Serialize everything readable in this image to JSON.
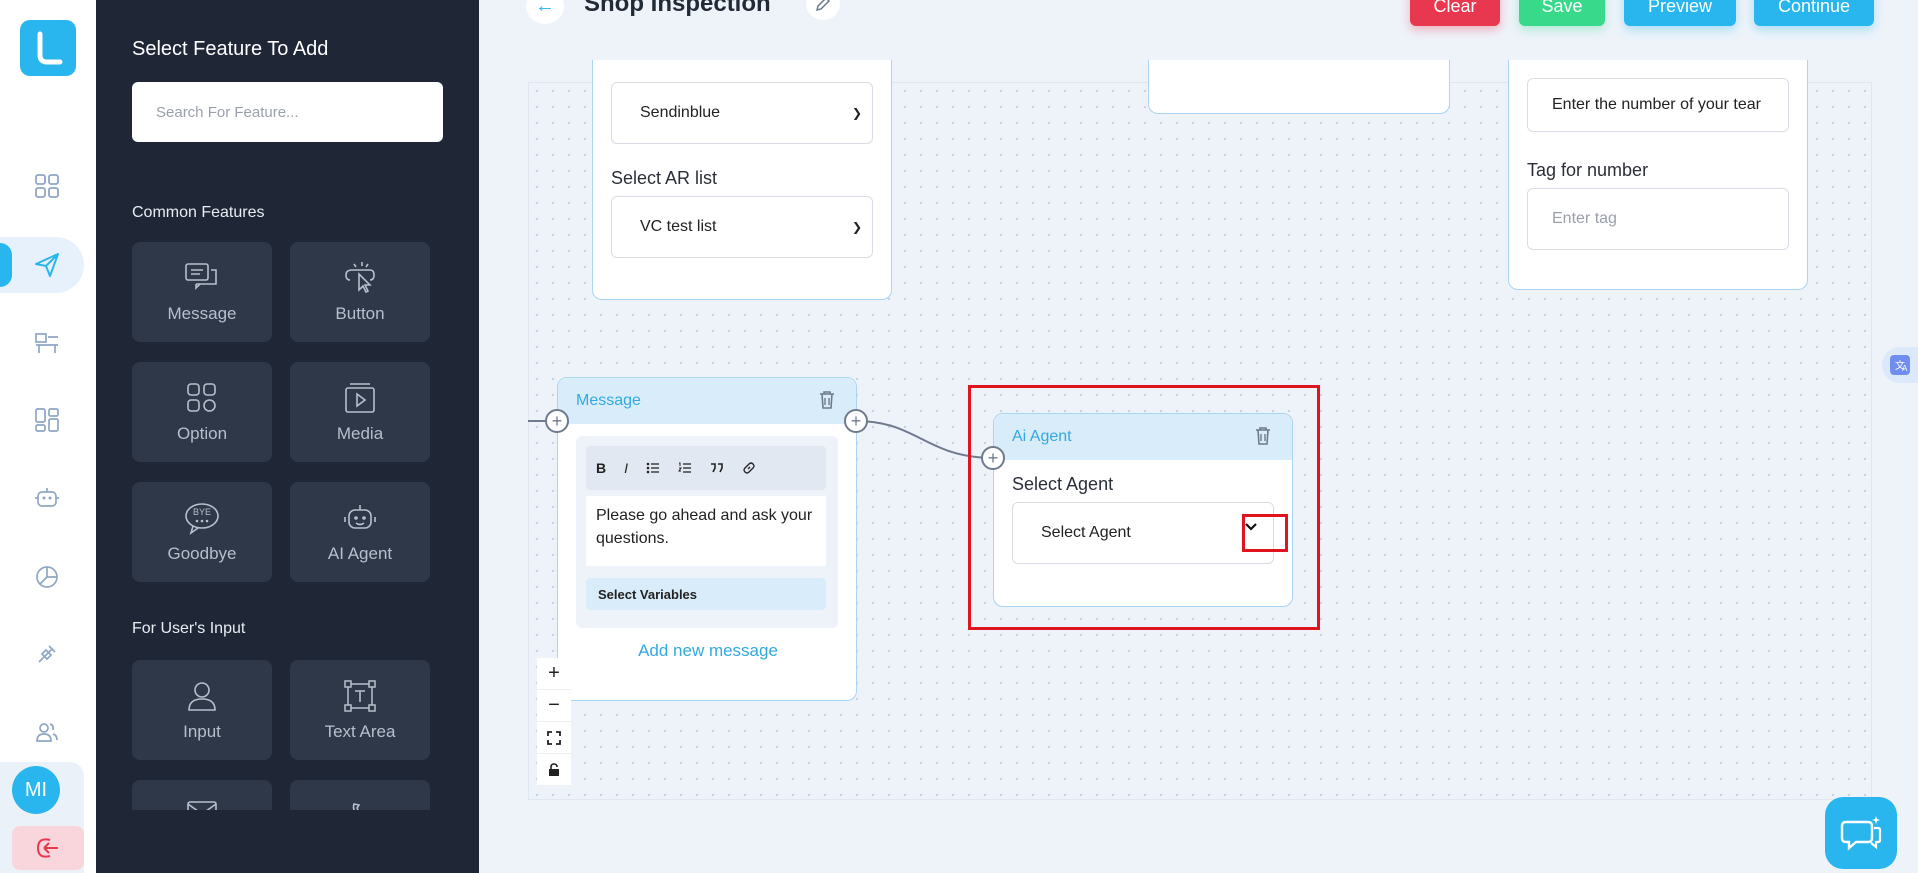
{
  "sidebar_rail": {
    "logo_letter": "L",
    "items": [
      {
        "name": "dashboard-icon"
      },
      {
        "name": "send-icon",
        "active": true
      },
      {
        "name": "desk-icon"
      },
      {
        "name": "apps-icon"
      },
      {
        "name": "bot-icon"
      },
      {
        "name": "chart-pie-icon"
      },
      {
        "name": "plug-icon"
      },
      {
        "name": "users-icon"
      }
    ],
    "avatar_initials": "MI"
  },
  "feature_panel": {
    "title": "Select Feature To Add",
    "search_placeholder": "Search For Feature...",
    "common_title": "Common Features",
    "common_features": [
      "Message",
      "Button",
      "Option",
      "Media",
      "Goodbye",
      "AI Agent"
    ],
    "user_input_title": "For User's Input",
    "user_input_features": [
      "Input",
      "Text Area"
    ]
  },
  "header": {
    "title": "Shop Inspection",
    "buttons": {
      "clear": "Clear",
      "save": "Save",
      "preview": "Preview",
      "continue": "Continue"
    }
  },
  "canvas": {
    "ar_card": {
      "provider_value": "Sendinblue",
      "list_label": "Select AR list",
      "list_value": "VC test list"
    },
    "team_card": {
      "number_input_value": "Enter the number of your tear",
      "tag_label": "Tag for number",
      "tag_placeholder": "Enter tag"
    },
    "message_node": {
      "title": "Message",
      "text": "Please go ahead and ask your questions.",
      "toolbar": [
        "B",
        "I"
      ],
      "select_variables": "Select Variables",
      "add_new": "Add new message"
    },
    "ai_agent_node": {
      "title": "Ai Agent",
      "label": "Select Agent",
      "select_value": "Select Agent"
    },
    "zoom_controls": [
      "+",
      "−"
    ]
  },
  "colors": {
    "accent": "#29b6ee",
    "clear": "#e8384f",
    "save": "#38d98b",
    "panel_bg": "#1f2736",
    "highlight": "#e0141e"
  }
}
